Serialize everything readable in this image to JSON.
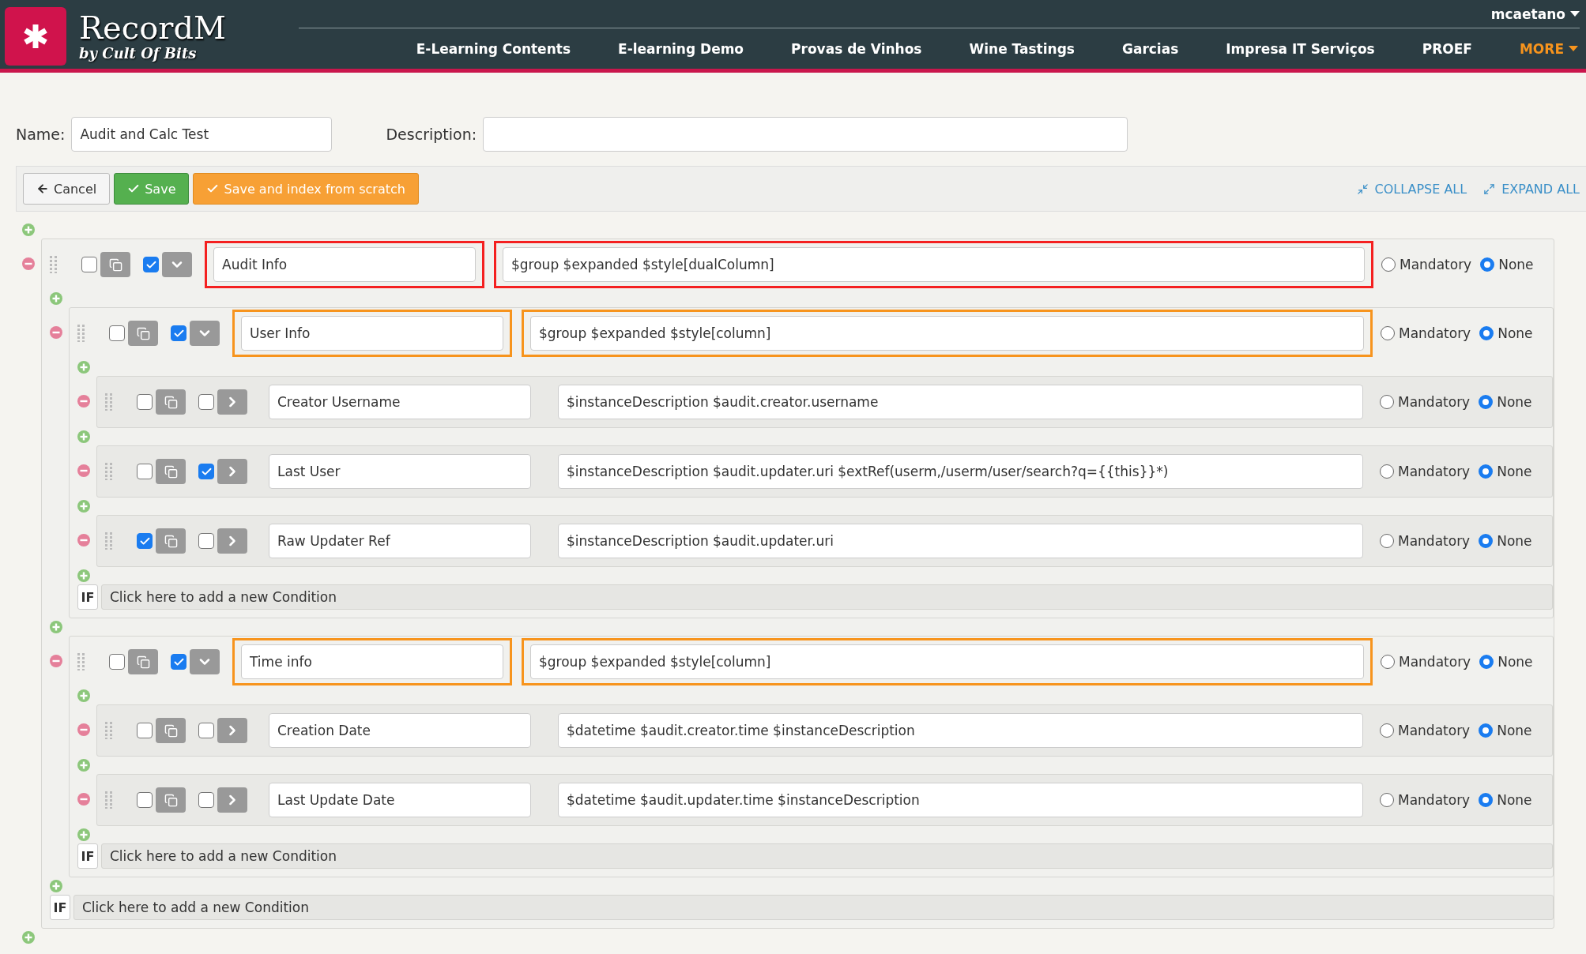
{
  "header": {
    "logo": {
      "title": "RecordM",
      "subtitle": "by Cult Of Bits"
    },
    "user": "mcaetano",
    "nav": [
      {
        "label": "E-Learning Contents",
        "kind": "link"
      },
      {
        "label": "E-learning Demo",
        "kind": "link"
      },
      {
        "label": "Provas de Vinhos",
        "kind": "link"
      },
      {
        "label": "Wine Tastings",
        "kind": "link"
      },
      {
        "label": "Garcias",
        "kind": "link"
      },
      {
        "label": "Impresa IT Serviços",
        "kind": "link"
      },
      {
        "label": "PROEF",
        "kind": "link"
      },
      {
        "label": "MORE",
        "kind": "menu"
      }
    ]
  },
  "form": {
    "name_label": "Name:",
    "name_value": "Audit and Calc Test",
    "description_label": "Description:"
  },
  "toolbar": {
    "buttons": [
      {
        "label": "Cancel",
        "kind": "cancel"
      },
      {
        "label": "Save",
        "kind": "save"
      },
      {
        "label": "Save and index from scratch",
        "kind": "index"
      }
    ],
    "links": [
      {
        "label": "COLLAPSE ALL",
        "kind": "collapse"
      },
      {
        "label": "EXPAND ALL",
        "kind": "expand"
      }
    ]
  },
  "tree": {
    "fields": [
      {
        "name": "Audit Info",
        "description": "$group $expanded $style[dualColumn]",
        "checked": false,
        "toggle_checked": true,
        "expanded": true,
        "color": "#f42020",
        "options": [
          {
            "label": "Mandatory",
            "selected": false
          },
          {
            "label": "None",
            "selected": true
          }
        ],
        "condition": {
          "badge": "IF",
          "text": "Click here to add a new Condition"
        },
        "children": [
          {
            "name": "User Info",
            "description": "$group $expanded $style[column]",
            "checked": false,
            "toggle_checked": true,
            "expanded": true,
            "color": "#f7941d",
            "options": [
              {
                "label": "Mandatory",
                "selected": false
              },
              {
                "label": "None",
                "selected": true
              }
            ],
            "condition": {
              "badge": "IF",
              "text": "Click here to add a new Condition"
            },
            "children": [
              {
                "name": "Creator Username",
                "description": "$instanceDescription $audit.creator.username",
                "checked": false,
                "toggle_checked": false,
                "expanded": false,
                "options": [
                  {
                    "label": "Mandatory",
                    "selected": false
                  },
                  {
                    "label": "None",
                    "selected": true
                  }
                ]
              },
              {
                "name": "Last User",
                "description": "$instanceDescription $audit.updater.uri $extRef(userm,/userm/user/search?q={{this}}*)",
                "checked": false,
                "toggle_checked": true,
                "expanded": false,
                "options": [
                  {
                    "label": "Mandatory",
                    "selected": false
                  },
                  {
                    "label": "None",
                    "selected": true
                  }
                ]
              },
              {
                "name": "Raw Updater Ref",
                "description": "$instanceDescription $audit.updater.uri",
                "checked": true,
                "toggle_checked": false,
                "expanded": false,
                "options": [
                  {
                    "label": "Mandatory",
                    "selected": false
                  },
                  {
                    "label": "None",
                    "selected": true
                  }
                ]
              }
            ]
          },
          {
            "name": "Time info",
            "description": "$group $expanded $style[column]",
            "checked": false,
            "toggle_checked": true,
            "expanded": true,
            "color": "#f7941d",
            "options": [
              {
                "label": "Mandatory",
                "selected": false
              },
              {
                "label": "None",
                "selected": true
              }
            ],
            "condition": {
              "badge": "IF",
              "text": "Click here to add a new Condition"
            },
            "children": [
              {
                "name": "Creation Date",
                "description": "$datetime $audit.creator.time $instanceDescription",
                "checked": false,
                "toggle_checked": false,
                "expanded": false,
                "options": [
                  {
                    "label": "Mandatory",
                    "selected": false
                  },
                  {
                    "label": "None",
                    "selected": true
                  }
                ]
              },
              {
                "name": "Last Update Date",
                "description": "$datetime $audit.updater.time $instanceDescription",
                "checked": false,
                "toggle_checked": false,
                "expanded": false,
                "options": [
                  {
                    "label": "Mandatory",
                    "selected": false
                  },
                  {
                    "label": "None",
                    "selected": true
                  }
                ]
              }
            ]
          }
        ]
      }
    ]
  }
}
